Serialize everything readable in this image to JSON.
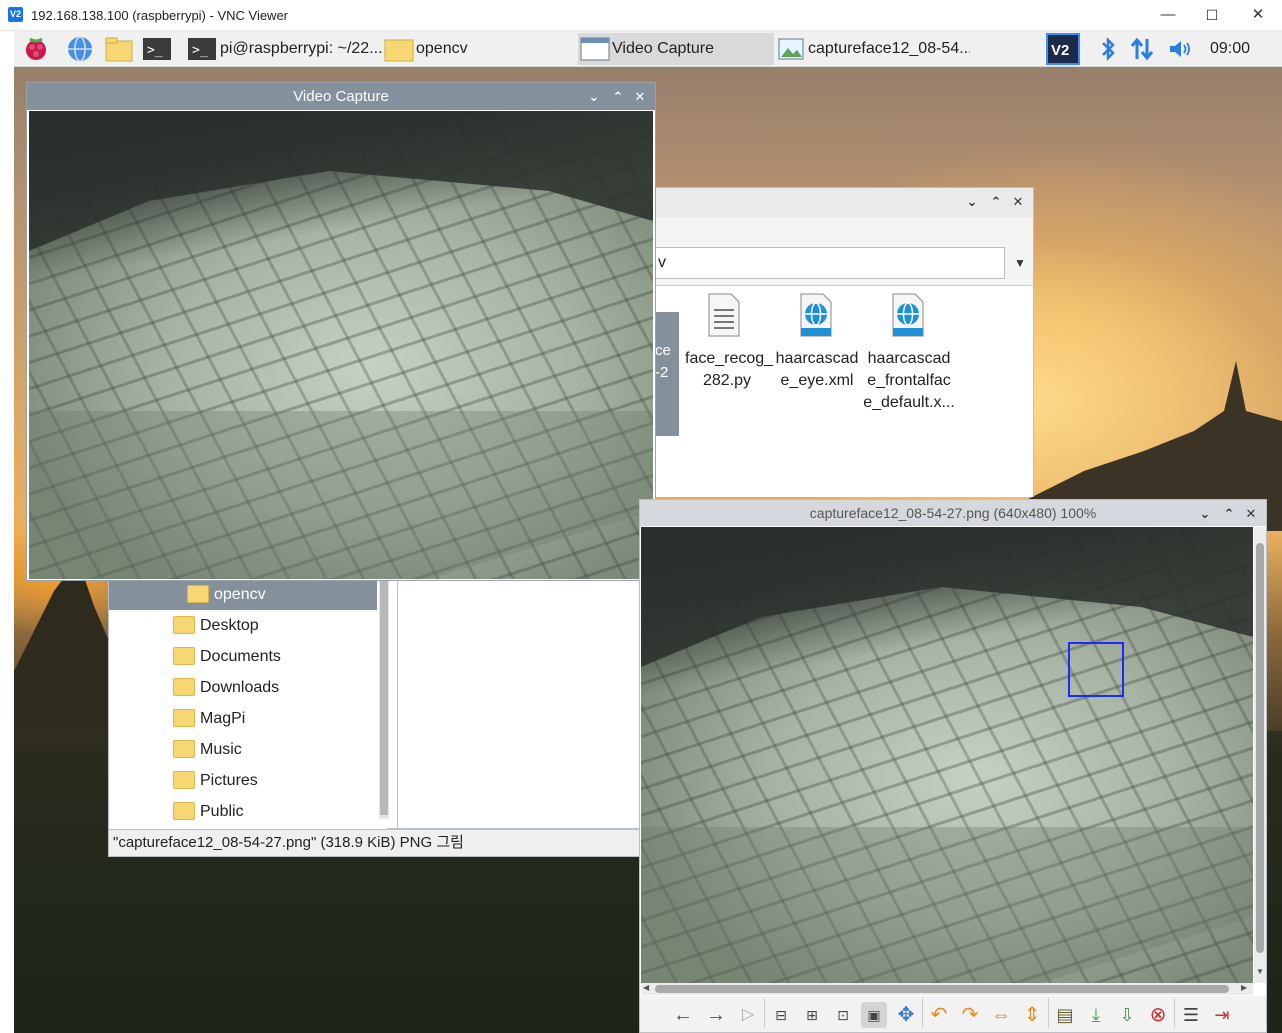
{
  "vnc": {
    "title": "192.168.138.100 (raspberrypi) - VNC Viewer",
    "logo": "V2",
    "minimize": "—",
    "maximize": "☐",
    "close": "✕"
  },
  "panel": {
    "tasks": [
      {
        "label": "pi@raspberrypi: ~/22...",
        "icon": "terminal-icon"
      },
      {
        "label": "opencv",
        "icon": "folder-icon"
      },
      {
        "label": "Video Capture",
        "icon": "window-icon"
      },
      {
        "label": "captureface12_08-54...",
        "icon": "image-icon"
      }
    ],
    "clock": "09:00",
    "tray": [
      "vnc-icon",
      "bluetooth-icon",
      "network-icon",
      "volume-icon"
    ]
  },
  "video_capture": {
    "title": "Video Capture"
  },
  "file_manager": {
    "path_value": "v",
    "files": [
      {
        "label": "ce\n-2",
        "icon": "file-icon"
      },
      {
        "label": "face_recog_\n282.py",
        "icon": "python-file-icon"
      },
      {
        "label": "haarcascad\ne_eye.xml",
        "icon": "xml-file-icon"
      },
      {
        "label": "haarcascad\ne_frontalfac\ne_default.x..."
      }
    ],
    "tree": [
      "opencv",
      "Desktop",
      "Documents",
      "Downloads",
      "MagPi",
      "Music",
      "Pictures",
      "Public"
    ],
    "status": "\"captureface12_08-54-27.png\" (318.9 KiB) PNG 그림"
  },
  "image_viewer": {
    "title": "captureface12_08-54-27.png (640x480) 100%"
  },
  "colors": {
    "panel_bg": "#f0f0f0",
    "title_active": "#84919d",
    "title_inactive": "#d5d9dd",
    "selection": "#84919d",
    "detection_box": "#1a2bff"
  }
}
